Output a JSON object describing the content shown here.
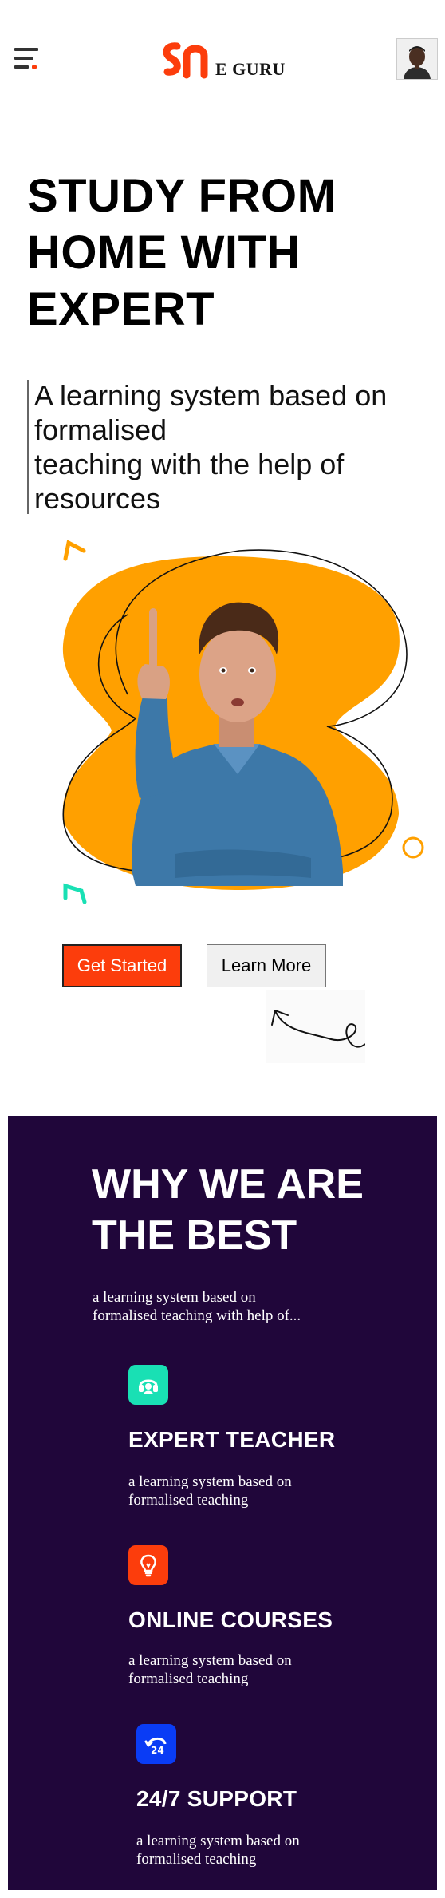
{
  "header": {
    "brand": "E GURU",
    "menu_icon": "hamburger-menu-icon",
    "logo_icon": "e-guru-logo",
    "avatar_icon": "user-avatar"
  },
  "hero": {
    "title_line1": "STUDY FROM",
    "title_line2": "HOME WITH",
    "title_line3": "EXPERT",
    "subtitle_line1": "A learning system based on",
    "subtitle_line2": "formalised",
    "subtitle_line3": "teaching with the help of",
    "subtitle_line4": "resources",
    "image_icon": "teacher-pointing-illustration",
    "primary_button": "Get Started",
    "secondary_button": "Learn More",
    "doodle_icon": "curved-arrow-icon"
  },
  "why": {
    "title_line1": "WHY WE ARE",
    "title_line2": "THE BEST",
    "subtitle_line1": "a learning system based on",
    "subtitle_line2": "formalised teaching with help of...",
    "features": [
      {
        "title": "EXPERT TEACHER",
        "desc_line1": "a learning system based on",
        "desc_line2": "formalised teaching",
        "icon": "headset-icon",
        "color": "#19e0b4"
      },
      {
        "title": "ONLINE COURSES",
        "desc_line1": "a learning system based on",
        "desc_line2": "formalised teaching",
        "icon": "lightbulb-icon",
        "color": "#fc3d0c"
      },
      {
        "title": "24/7 SUPPORT",
        "desc_line1": "a learning system based on",
        "desc_line2": "formalised teaching",
        "icon": "24-hours-icon",
        "color": "#0a3cf5"
      }
    ]
  },
  "colors": {
    "accent_orange": "#fc3d0c",
    "blob_yellow": "#ffa000",
    "section_purple": "#20063a",
    "teal": "#19e0b4",
    "blue": "#0a3cf5"
  }
}
